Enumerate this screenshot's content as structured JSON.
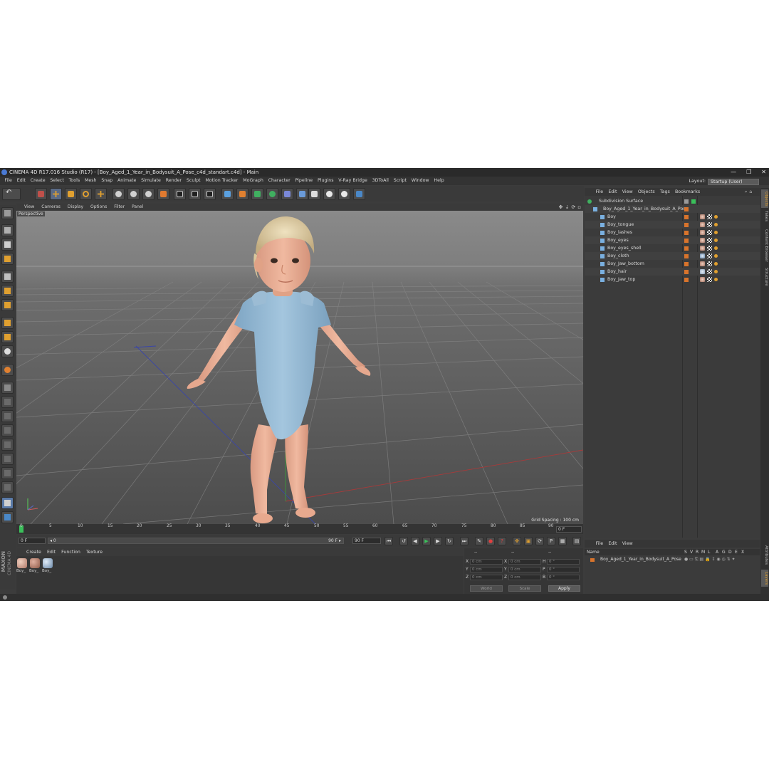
{
  "window": {
    "title": "CINEMA 4D R17.016 Studio (R17) - [Boy_Aged_1_Year_in_Bodysuit_A_Pose_c4d_standart.c4d] - Main",
    "controls": [
      "—",
      "❐",
      "✕"
    ]
  },
  "menubar": {
    "items": [
      "File",
      "Edit",
      "Create",
      "Select",
      "Tools",
      "Mesh",
      "Snap",
      "Animate",
      "Simulate",
      "Render",
      "Sculpt",
      "Motion Tracker",
      "MoGraph",
      "Character",
      "Pipeline",
      "Plugins",
      "V-Ray Bridge",
      "3DToAll",
      "Script",
      "Window",
      "Help"
    ],
    "layout_label": "Layout:",
    "layout_value": "Startup (User)"
  },
  "viewport": {
    "menu": [
      "View",
      "Cameras",
      "Display",
      "Options",
      "Filter",
      "Panel"
    ],
    "camera_label": "Perspective",
    "grid_spacing": "Grid Spacing : 100 cm",
    "icons": [
      "move-view-icon",
      "down-arrow-icon",
      "rotate-view-icon",
      "maximize-icon"
    ]
  },
  "timeline": {
    "ticks": [
      "0",
      "5",
      "10",
      "15",
      "20",
      "25",
      "30",
      "35",
      "40",
      "45",
      "50",
      "55",
      "60",
      "65",
      "70",
      "75",
      "80",
      "85",
      "90"
    ],
    "current_frame": "0 F"
  },
  "transport": {
    "start": "0 F",
    "range_left": "◂ 0",
    "range_right": "90 F ▸",
    "end": "90 F"
  },
  "material_manager": {
    "menu": [
      "Create",
      "Edit",
      "Function",
      "Texture"
    ],
    "materials": [
      {
        "label": "Boy_",
        "color": "#c89a88"
      },
      {
        "label": "Boy_",
        "color": "#b8806a"
      },
      {
        "label": "Boy_",
        "color": "#9ab0c4"
      }
    ]
  },
  "coordinates": {
    "header": [
      "--",
      "--",
      "--"
    ],
    "rows": [
      {
        "a": "X",
        "a_val": "0 cm",
        "b": "X",
        "b_val": "0 cm",
        "c": "H",
        "c_val": "0 °"
      },
      {
        "a": "Y",
        "a_val": "0 cm",
        "b": "Y",
        "b_val": "0 cm",
        "c": "P",
        "c_val": "0 °"
      },
      {
        "a": "Z",
        "a_val": "0 cm",
        "b": "Z",
        "b_val": "0 cm",
        "c": "B",
        "c_val": "0 °"
      }
    ],
    "world": "World",
    "scale": "Scale",
    "apply": "Apply"
  },
  "object_manager": {
    "menu": [
      "File",
      "Edit",
      "View",
      "Objects",
      "Tags",
      "Bookmarks"
    ],
    "objects": [
      {
        "name": "Subdivision Surface",
        "indent": 0
      },
      {
        "name": "Boy_Aged_1_Year_in_Bodysuit_A_Pose",
        "indent": 1
      },
      {
        "name": "Boy",
        "indent": 2
      },
      {
        "name": "Boy_tongue",
        "indent": 2
      },
      {
        "name": "Boy_lashes",
        "indent": 2
      },
      {
        "name": "Boy_eyes",
        "indent": 2
      },
      {
        "name": "Boy_eyes_shell",
        "indent": 2
      },
      {
        "name": "Boy_cloth",
        "indent": 2
      },
      {
        "name": "Boy_Jaw_bottom",
        "indent": 2
      },
      {
        "name": "Boy_hair",
        "indent": 2
      },
      {
        "name": "Boy_Jaw_top",
        "indent": 2
      }
    ]
  },
  "attribute_manager": {
    "menu": [
      "File",
      "Edit",
      "View"
    ],
    "columns": [
      "Name",
      "S",
      "V",
      "R",
      "M",
      "L",
      "A",
      "G",
      "D",
      "E",
      "X"
    ],
    "row_name": "Boy_Aged_1_Year_in_Bodysuit_A_Pose"
  },
  "right_tabs": [
    "Objects",
    "Takes",
    "Content Browser",
    "Structure",
    "Attributes",
    "Layers"
  ],
  "branding": {
    "line1": "MAXON",
    "line2": "CINEMA 4D"
  },
  "colors": {
    "accent": "#4a7ad4",
    "tag_orange": "#d8742c",
    "bodysuit": "#8fb6d2",
    "skin": "#e8ab92"
  }
}
